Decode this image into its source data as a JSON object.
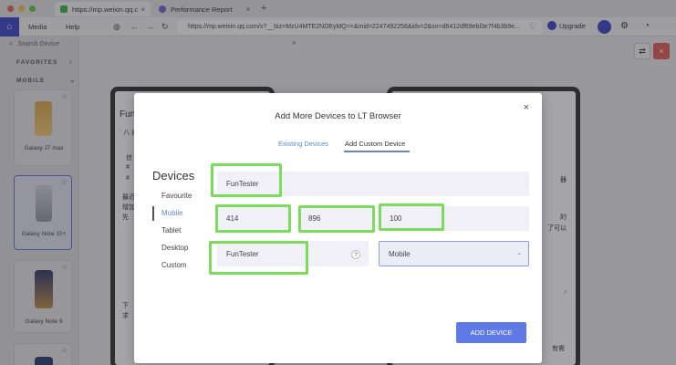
{
  "browser": {
    "tabs": [
      {
        "label": "https://mp.weixin.qq.c"
      },
      {
        "label": "Performance Report"
      }
    ],
    "new_tab": "+",
    "menu": [
      "Media",
      "Help"
    ],
    "url": "https://mp.weixin.qq.com/s?__biz=MzU4MTE2NDEyMQ==&mid=2247492256&idx=2&sn=d6412df69ebl3e7f4b3b9e...",
    "upgrade_label": "Upgrade"
  },
  "sidebar": {
    "search_placeholder": "Search Device",
    "favorites_label": "FAVORITES",
    "mobile_label": "MOBILE",
    "devices": [
      {
        "name": "Galaxy J7 max"
      },
      {
        "name": "Galaxy Note 10+"
      },
      {
        "name": "Galaxy Note 9"
      }
    ]
  },
  "background": {
    "left_frame_text": [
      "Fun",
      "ʾ​ 八 自",
      "信",
      "#",
      "#",
      "最近",
      "增加",
      "先"
    ],
    "right_frame_text": [
      "器",
      "的",
      "了可以"
    ],
    "bottom_text": [
      "下",
      "求",
      "有需"
    ]
  },
  "modal": {
    "title": "Add More Devices to LT Browser",
    "tabs": {
      "existing": "Existing Devices",
      "custom": "Add Custom Device"
    },
    "devices_heading": "Devices",
    "categories": [
      "Favourite",
      "Mobile",
      "Tablet",
      "Desktop",
      "Custom"
    ],
    "active_category": "Mobile",
    "fields": {
      "device_name": "FunTester",
      "width": "414",
      "height": "896",
      "scale": "100",
      "user_agent": "FunTester",
      "help": "?",
      "device_type": "Mobile"
    },
    "close": "×",
    "add_button": "ADD DEVICE"
  },
  "colors": {
    "accent": "#5f7ae6",
    "highlight": "#7bdc5b",
    "nav_blue": "#3b45c9"
  }
}
